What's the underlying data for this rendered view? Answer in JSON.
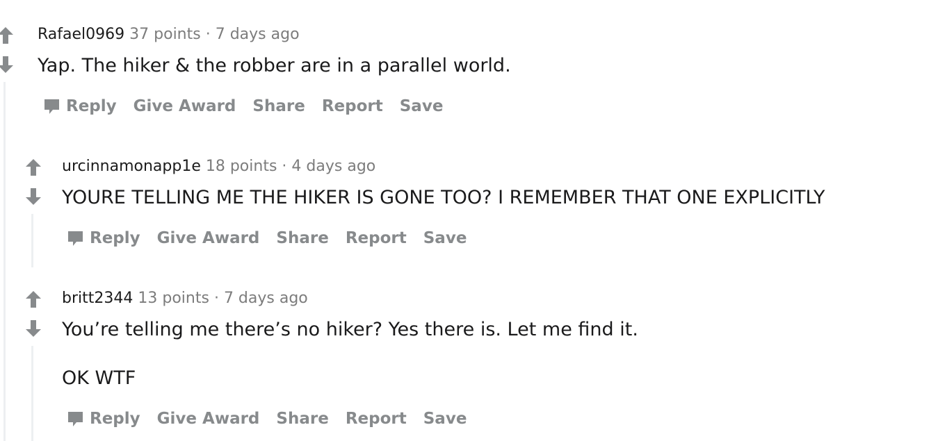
{
  "colors": {
    "icon_gray": "#878a8c",
    "thread_line": "#edeff1",
    "muted_text": "#7c7c7c"
  },
  "comments": [
    {
      "author": "Rafael0969",
      "points": "37 points",
      "sep": "·",
      "time": "7 days ago",
      "body": [
        "Yap. The hiker & the robber are in a parallel world."
      ],
      "actions": {
        "reply": "Reply",
        "award": "Give Award",
        "share": "Share",
        "report": "Report",
        "save": "Save"
      }
    },
    {
      "author": "urcinnamonapp1e",
      "points": "18 points",
      "sep": "·",
      "time": "4 days ago",
      "body": [
        "YOURE TELLING ME THE HIKER IS GONE TOO? I REMEMBER THAT ONE EXPLICITLY"
      ],
      "actions": {
        "reply": "Reply",
        "award": "Give Award",
        "share": "Share",
        "report": "Report",
        "save": "Save"
      }
    },
    {
      "author": "britt2344",
      "points": "13 points",
      "sep": "·",
      "time": "7 days ago",
      "body": [
        "You’re telling me there’s no hiker? Yes there is. Let me find it.",
        "OK WTF"
      ],
      "actions": {
        "reply": "Reply",
        "award": "Give Award",
        "share": "Share",
        "report": "Report",
        "save": "Save"
      }
    }
  ]
}
